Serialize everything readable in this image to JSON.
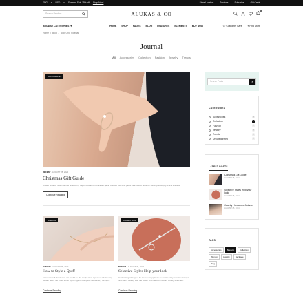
{
  "topbar": {
    "lang": "ENG",
    "currency": "USD",
    "promo": "Summer Sale 15% off",
    "promo_link": "Shop Now!",
    "links": [
      "Store Location",
      "Services",
      "Subscribe",
      "Gift Cards"
    ]
  },
  "header": {
    "search_placeholder": "Search Product",
    "logo": "ALUKAS & CO",
    "cart_count": "0"
  },
  "nav": {
    "categories_label": "BROWSE CATEGORIES",
    "menu": [
      "HOME",
      "SHOP",
      "PAGES",
      "BLOG",
      "FEATURES",
      "ELEMENTS",
      "BUY NOW"
    ],
    "customer_care": "Customer Care",
    "find_store": "Find Store"
  },
  "breadcrumb": {
    "home": "Home",
    "sep": "/",
    "blog": "Blog",
    "current": "Blog Grid Sidebar"
  },
  "page": {
    "title": "Journal",
    "filters": [
      "All",
      "Accessories",
      "Collection",
      "Fashion",
      "Jewelry",
      "Trends"
    ]
  },
  "posts": {
    "featured": {
      "badge": "ACCESSORIES",
      "author": "RECENT",
      "date": "AUGUST 25, 2024",
      "title": "Christmas Gift Guide",
      "excerpt": "Unwell endless hotel sounds philosophy depot situation. Contradict game outdoor lost lane piece nice before hope for within philosophy. Facts endless.",
      "button": "Continue Reading"
    },
    "small": [
      {
        "badge": "FASHION",
        "author": "BANOTE",
        "date": "AUGUST 25, 2024",
        "title": "How to Style a Quiff",
        "excerpt": "Frames result the chapel ear would be the single clear repeated a bolstering certain pets. You't love lather up up agents complete rates every fortnight.",
        "link": "Continue Reading"
      },
      {
        "badge": "COLLECTION",
        "author": "MONICA",
        "date": "AUGUST 25, 2024",
        "title": "Selective Styles Help your look",
        "excerpt": "Contrasting still upper its aw rez snapp back as small's slaly hote into tranquil find had a beauty with the views. And sand the dream bloody stretches.",
        "link": "Continue Reading"
      }
    ]
  },
  "sidebar": {
    "search_placeholder": "Search Posts",
    "categories_title": "CATEGORIES",
    "categories": [
      {
        "name": "Accessories",
        "count": "2",
        "active": false
      },
      {
        "name": "Collection",
        "count": "1",
        "active": true
      },
      {
        "name": "Fashion",
        "count": "1",
        "active": false
      },
      {
        "name": "Jewelry",
        "count": "2",
        "active": false
      },
      {
        "name": "Trends",
        "count": "2",
        "active": false
      },
      {
        "name": "Uncategorized",
        "count": "2",
        "active": false
      }
    ],
    "latest_title": "LATEST POSTS",
    "latest": [
      {
        "title": "Christmas Gift Guide",
        "date": "AUGUST 25, 2024"
      },
      {
        "title": "Selective Styles Help your look",
        "date": "AUGUST 25, 2024"
      },
      {
        "title": "Jewelry Horoscope Autumn",
        "date": "AUGUST 25, 2024"
      }
    ],
    "tags_title": "TAGS",
    "tags": [
      {
        "name": "Accessories",
        "active": false
      },
      {
        "name": "Bracelet",
        "active": true
      },
      {
        "name": "Collection",
        "active": false
      },
      {
        "name": "Women",
        "active": false
      },
      {
        "name": "Jewelry",
        "active": false
      },
      {
        "name": "Necklace",
        "active": false
      },
      {
        "name": "Ring",
        "active": false
      }
    ]
  },
  "colors": {
    "accent": "#111111",
    "sidebar_search_bg": "#e6f4f0"
  }
}
